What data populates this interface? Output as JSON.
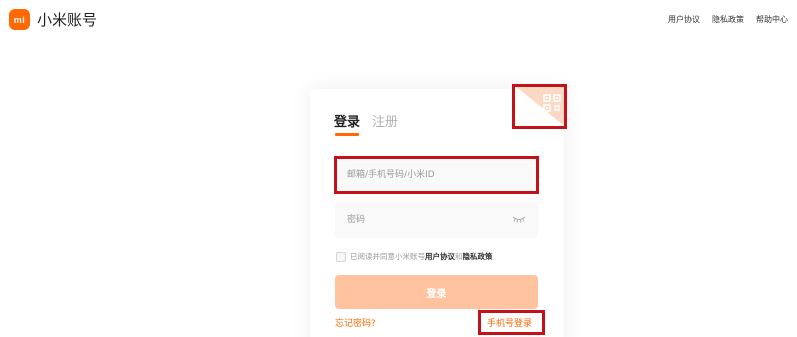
{
  "header": {
    "logo_text": "mi",
    "brand": "小米账号",
    "nav": [
      "用户协议",
      "隐私政策",
      "帮助中心"
    ]
  },
  "login": {
    "tabs": [
      "登录",
      "注册"
    ],
    "active_tab": "登录",
    "email_placeholder": "邮箱/手机号码/小米ID",
    "password_placeholder": "密码",
    "agreement": {
      "prefix": "已阅读并同意小米账号",
      "terms": "用户协议",
      "and": "和",
      "privacy": "隐私政策"
    },
    "login_button": "登录",
    "forgot_password": "忘记密码?",
    "phone_login": "手机号登录"
  },
  "colors": {
    "accent": "#ff6900",
    "button_disabled": "#ffc3a0",
    "highlight_box": "#c4121b",
    "field_bg": "#f9f9f9"
  },
  "icons": {
    "qr": "qr-code-icon",
    "eye": "eye-closed-icon"
  }
}
